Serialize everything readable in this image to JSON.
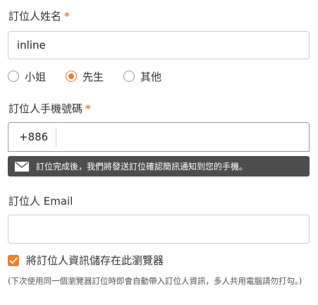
{
  "colors": {
    "accent": "#f07c2f",
    "hint_bg": "#4d4d4d",
    "border": "#cccccc"
  },
  "name_field": {
    "label": "訂位人姓名",
    "required_mark": "*",
    "value": "inline"
  },
  "title_options": [
    {
      "label": "小姐",
      "selected": false
    },
    {
      "label": "先生",
      "selected": true
    },
    {
      "label": "其他",
      "selected": false
    }
  ],
  "phone_field": {
    "label": "訂位人手機號碼",
    "required_mark": "*",
    "country_code": "+886",
    "value": ""
  },
  "sms_hint": {
    "icon": "mail-icon",
    "text": "訂位完成後，我們將發送訂位確認簡訊通知到您的手機。"
  },
  "email_field": {
    "label": "訂位人 Email",
    "value": ""
  },
  "save_info": {
    "checked": true,
    "label": "將訂位人資訊儲存在此瀏覽器",
    "note": "(下次使用同一個瀏覽器訂位時即會自動帶入訂位人資訊，多人共用電腦請勿打勾。)"
  }
}
